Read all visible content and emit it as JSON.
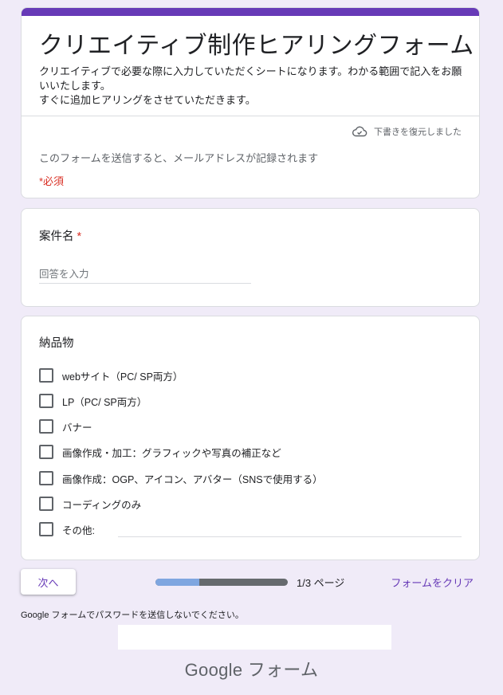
{
  "header": {
    "title": "クリエイティブ制作ヒアリングフォーム",
    "description_line1": "クリエイティブで必要な際に入力していただくシートになります。わかる範囲で記入をお願いいたします。",
    "description_line2": "すぐに追加ヒアリングをさせていただきます。",
    "draft_status": "下書きを復元しました",
    "email_note": "このフォームを送信すると、メールアドレスが記録されます",
    "required_note": "*必須"
  },
  "project_name": {
    "label": "案件名",
    "required_mark": "*",
    "placeholder": "回答を入力"
  },
  "deliverables": {
    "label": "納品物",
    "options": [
      "webサイト（PC/ SP両方）",
      "LP（PC/ SP両方）",
      "バナー",
      "画像作成・加工：グラフィックや写真の補正など",
      "画像作成：OGP、アイコン、アバター（SNSで使用する）",
      "コーディングのみ",
      "その他:"
    ]
  },
  "nav": {
    "next_label": "次へ",
    "progress_fraction": 0.33,
    "page_indicator": "1/3 ページ",
    "clear_label": "フォームをクリア"
  },
  "footer": {
    "password_warning": "Google フォームでパスワードを送信しないでください。",
    "logo_text": "Google フォーム"
  },
  "colors": {
    "accent": "#673ab7",
    "required": "#d93025",
    "background": "#f0ebf8",
    "progress_fill": "#7fa6e0",
    "progress_track": "#666a6e"
  }
}
